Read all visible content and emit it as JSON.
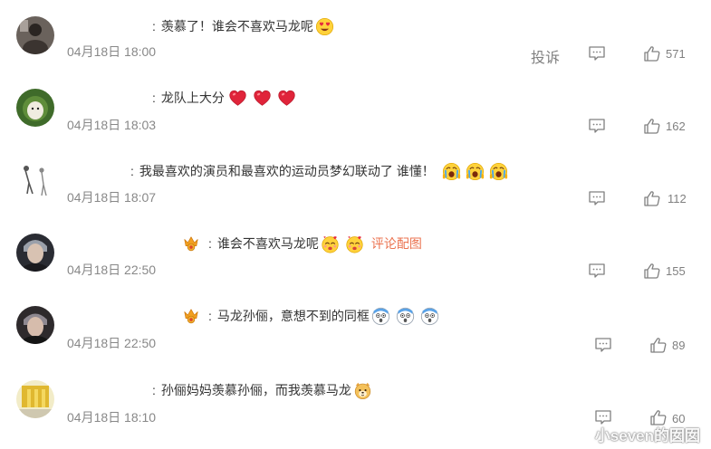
{
  "colors": {
    "time": "#888888",
    "action": "#808080",
    "link": "#eb7350"
  },
  "comments": [
    {
      "text": "羡慕了！谁会不喜欢马龙呢",
      "time": "04月18日 18:00",
      "likes": "571",
      "report_label": "投诉",
      "emojis": [
        "heart-eyes-face"
      ]
    },
    {
      "text": "龙队上大分",
      "time": "04月18日 18:03",
      "likes": "162",
      "emojis": [
        "red-heart",
        "red-heart",
        "red-heart"
      ]
    },
    {
      "text": "我最喜欢的演员和最喜欢的运动员梦幻联动了 谁懂！",
      "time": "04月18日 18:07",
      "likes": "112",
      "emojis": [
        "scream-face",
        "scream-face",
        "scream-face"
      ]
    },
    {
      "text": "谁会不喜欢马龙呢",
      "time": "04月18日 22:50",
      "likes": "155",
      "pic_link": "评论配图",
      "emojis": [
        "love-face",
        "love-face"
      ]
    },
    {
      "text": "马龙孙俪，意想不到的同框",
      "time": "04月18日 22:50",
      "likes": "89",
      "emojis": [
        "shocked-face",
        "shocked-face",
        "shocked-face"
      ]
    },
    {
      "text": "孙俪妈妈羡慕孙俪，而我羡慕马龙",
      "time": "04月18日 18:10",
      "likes": "60",
      "emojis": [
        "dog-face"
      ]
    }
  ],
  "watermark": "小seven的囡囡"
}
